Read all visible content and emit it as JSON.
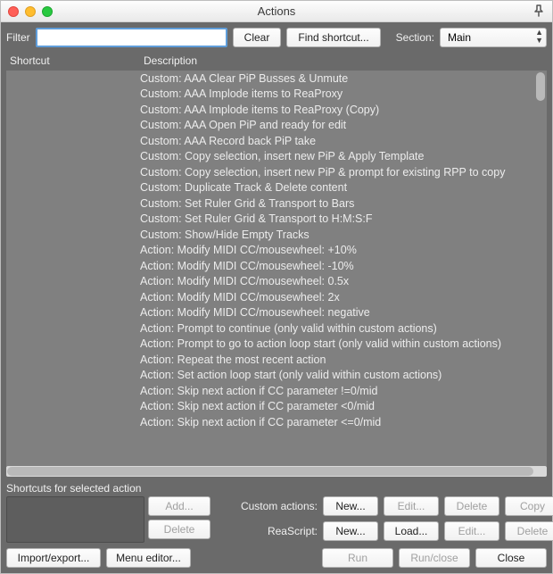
{
  "window_title": "Actions",
  "filter_label": "Filter",
  "filter_value": "",
  "clear_label": "Clear",
  "find_shortcut_label": "Find shortcut...",
  "section_label": "Section:",
  "section_value": "Main",
  "columns": {
    "shortcut": "Shortcut",
    "description": "Description"
  },
  "items": [
    {
      "shortcut": "",
      "description": "Custom: AAA Clear PiP Busses & Unmute"
    },
    {
      "shortcut": "",
      "description": "Custom: AAA Implode items to ReaProxy"
    },
    {
      "shortcut": "",
      "description": "Custom: AAA Implode items to ReaProxy (Copy)"
    },
    {
      "shortcut": "",
      "description": "Custom: AAA Open PiP and ready for edit"
    },
    {
      "shortcut": "",
      "description": "Custom: AAA Record back PiP take"
    },
    {
      "shortcut": "",
      "description": "Custom: Copy selection, insert new PiP & Apply Template"
    },
    {
      "shortcut": "",
      "description": "Custom: Copy selection, insert new PiP & prompt for existing RPP to copy"
    },
    {
      "shortcut": "",
      "description": "Custom: Duplicate Track & Delete content"
    },
    {
      "shortcut": "",
      "description": "Custom: Set Ruler Grid & Transport to Bars"
    },
    {
      "shortcut": "",
      "description": "Custom: Set Ruler Grid & Transport to H:M:S:F"
    },
    {
      "shortcut": "",
      "description": "Custom: Show/Hide Empty Tracks"
    },
    {
      "shortcut": "",
      "description": "Action: Modify MIDI CC/mousewheel: +10%"
    },
    {
      "shortcut": "",
      "description": "Action: Modify MIDI CC/mousewheel: -10%"
    },
    {
      "shortcut": "",
      "description": "Action: Modify MIDI CC/mousewheel: 0.5x"
    },
    {
      "shortcut": "",
      "description": "Action: Modify MIDI CC/mousewheel: 2x"
    },
    {
      "shortcut": "",
      "description": "Action: Modify MIDI CC/mousewheel: negative"
    },
    {
      "shortcut": "",
      "description": "Action: Prompt to continue (only valid within custom actions)"
    },
    {
      "shortcut": "",
      "description": "Action: Prompt to go to action loop start (only valid within custom actions)"
    },
    {
      "shortcut": "",
      "description": "Action: Repeat the most recent action"
    },
    {
      "shortcut": "",
      "description": "Action: Set action loop start (only valid within custom actions)"
    },
    {
      "shortcut": "",
      "description": "Action: Skip next action if CC parameter !=0/mid"
    },
    {
      "shortcut": "",
      "description": "Action: Skip next action if CC parameter <0/mid"
    },
    {
      "shortcut": "",
      "description": "Action: Skip next action if CC parameter <=0/mid"
    }
  ],
  "shortcuts_title": "Shortcuts for selected action",
  "add_label": "Add...",
  "delete_label": "Delete",
  "custom_actions_label": "Custom actions:",
  "reascript_label": "ReaScript:",
  "new_label": "New...",
  "edit_label": "Edit...",
  "delete2_label": "Delete",
  "copy_label": "Copy",
  "load_label": "Load...",
  "import_export_label": "Import/export...",
  "menu_editor_label": "Menu editor...",
  "run_label": "Run",
  "run_close_label": "Run/close",
  "close_label": "Close"
}
